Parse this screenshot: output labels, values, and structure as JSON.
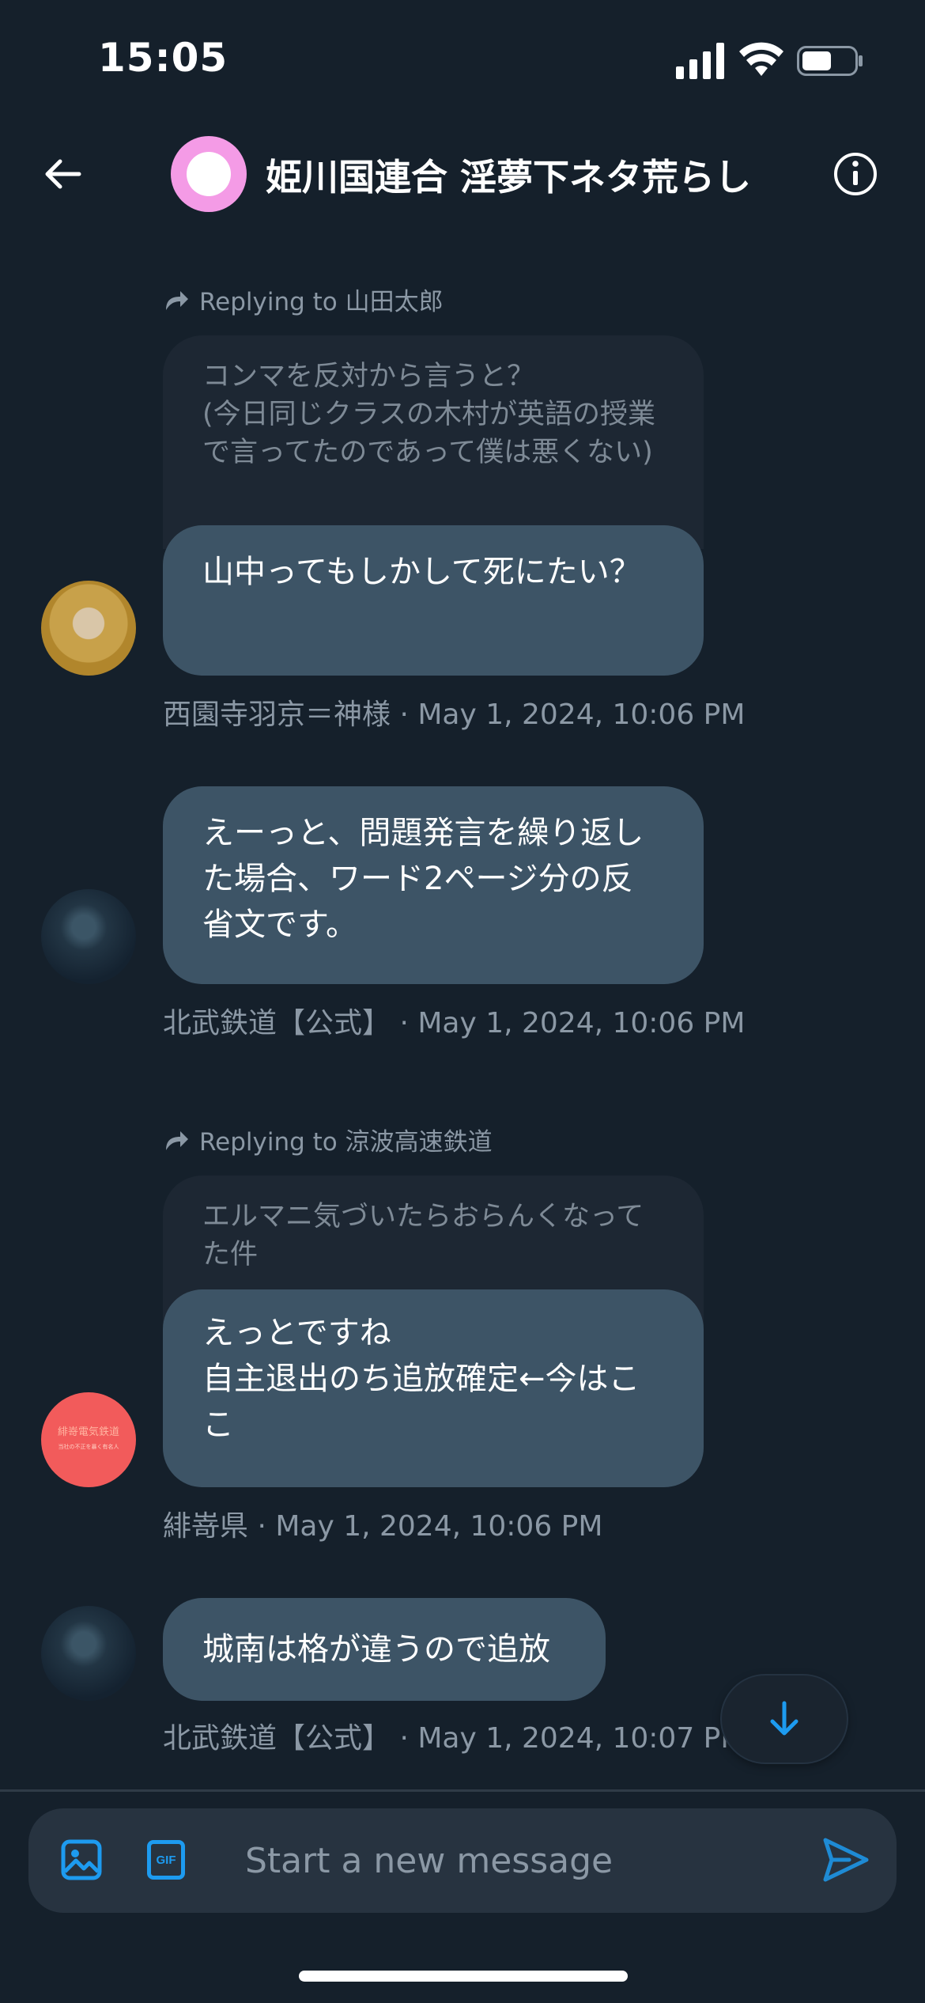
{
  "status_bar": {
    "time": "15:05"
  },
  "header": {
    "title": "姫川国連合 淫夢下ネタ荒らし"
  },
  "messages": [
    {
      "reply_to": "Replying to 山田太郎",
      "quoted_text": "コンマを反対から言うと？\n(今日同じクラスの木村が英語の授業で言ってたのであって僕は悪くない)",
      "text": "山中ってもしかして死にたい？",
      "meta": "西園寺羽京＝神様 · May 1, 2024, 10:06 PM",
      "avatar": "anime-character-avatar"
    },
    {
      "text": "えーっと、問題発言を繰り返した場合、ワード2ページ分の反省文です。",
      "meta": "北武鉄道【公式】 · May 1, 2024, 10:06 PM",
      "avatar": "night-station-avatar"
    },
    {
      "reply_to": "Replying to 涼波高速鉄道",
      "quoted_text": "エルマニ気づいたらおらんくなってた件",
      "text": "えっとですね\n自主退出のち追放確定←今はここ",
      "meta": "緋嵜県 · May 1, 2024, 10:06 PM",
      "avatar": "red-logo-avatar",
      "avatar_text": "緋嵜電気鉄道",
      "avatar_subtext": "当社の不正を暴く有名人"
    },
    {
      "text": "城南は格が違うので追放",
      "meta": "北武鉄道【公式】 · May 1, 2024, 10:07 PM",
      "avatar": "night-station-avatar"
    }
  ],
  "composer": {
    "placeholder": "Start a new message",
    "gif_label": "GIF"
  },
  "colors": {
    "background": "#15202b",
    "bubble": "#3d5466",
    "quoted": "#1d2733",
    "accent": "#1d9bf0",
    "header_avatar": "#f49be6"
  }
}
